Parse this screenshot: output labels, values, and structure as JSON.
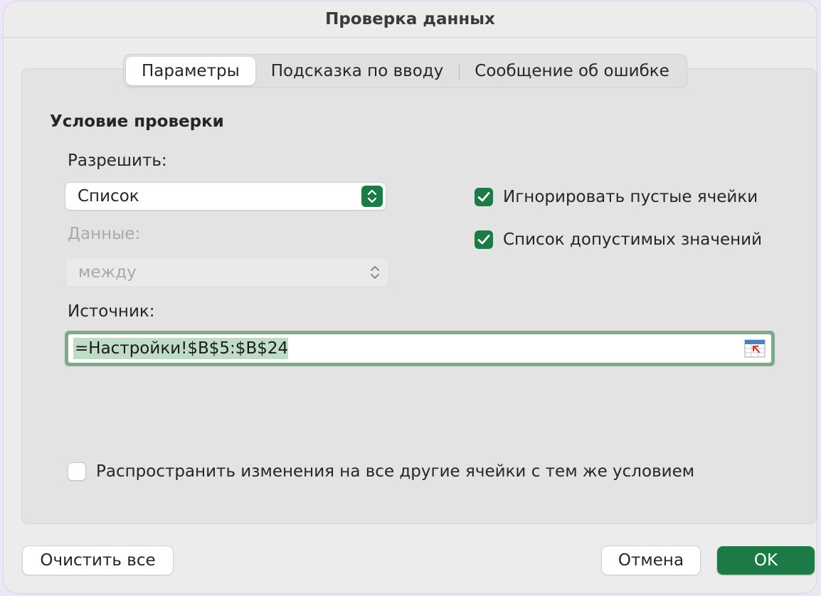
{
  "window": {
    "title": "Проверка данных"
  },
  "tabs": [
    {
      "label": "Параметры",
      "active": true
    },
    {
      "label": "Подсказка по вводу",
      "active": false
    },
    {
      "label": "Сообщение об ошибке",
      "active": false
    }
  ],
  "validation": {
    "section_title": "Условие проверки",
    "allow_label": "Разрешить:",
    "allow_value": "Список",
    "data_label": "Данные:",
    "data_value": "между",
    "data_disabled": true,
    "source_label": "Источник:",
    "source_value": "=Настройки!$B$5:$B$24"
  },
  "options": {
    "ignore_blank": {
      "label": "Игнорировать пустые ячейки",
      "checked": true
    },
    "in_cell_dropdown": {
      "label": "Список допустимых значений",
      "checked": true
    },
    "apply_to_all": {
      "label": "Распространить изменения на все другие ячейки с тем же условием",
      "checked": false
    }
  },
  "buttons": {
    "clear_all": "Очистить все",
    "cancel": "Отмена",
    "ok": "OK"
  },
  "colors": {
    "accent": "#1b7a45",
    "selection": "#bfdcc5",
    "focus_ring": "#7fa88c"
  },
  "icons": {
    "stepper": "chevron-up-down-icon",
    "checkmark": "checkmark-icon",
    "collapse_dialog": "range-select-icon"
  }
}
